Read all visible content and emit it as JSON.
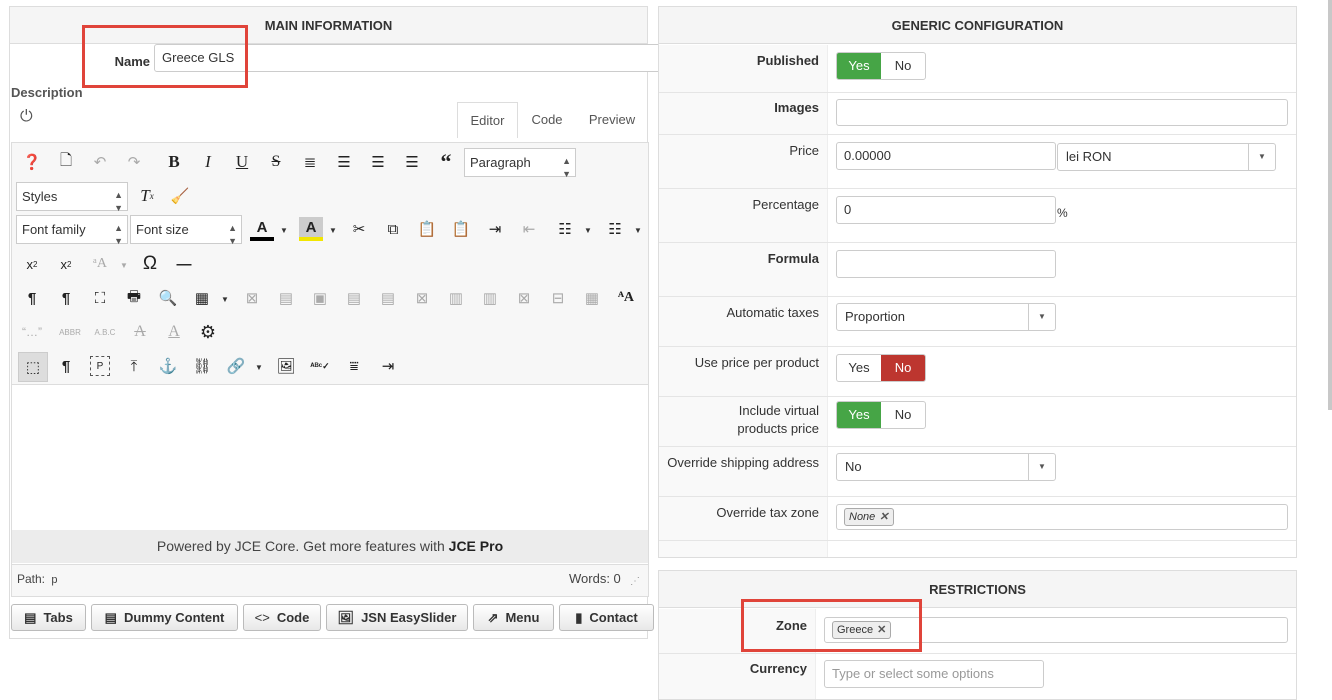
{
  "main": {
    "header": "MAIN INFORMATION",
    "name_label": "Name",
    "name_value": "Greece GLS",
    "description_label": "Description",
    "editor_tabs": [
      "Editor",
      "Code",
      "Preview"
    ],
    "paragraph_select": "Paragraph",
    "styles_select": "Styles",
    "font_family_select": "Font family",
    "font_size_select": "Font size",
    "powered_prefix": "Powered by JCE Core. Get more features with ",
    "powered_link": "JCE Pro",
    "path_label": "Path:",
    "path_value": "p",
    "words_label": "Words: 0",
    "buttons": [
      "Tabs",
      "Dummy Content",
      "Code",
      "JSN EasySlider",
      "Menu",
      "Contact"
    ]
  },
  "generic": {
    "header": "GENERIC CONFIGURATION",
    "published_label": "Published",
    "yes": "Yes",
    "no": "No",
    "images_label": "Images",
    "price_label": "Price",
    "price_value": "0.00000",
    "currency_value": "lei RON",
    "percentage_label": "Percentage",
    "percentage_value": "0",
    "percent_sign": "%",
    "formula_label": "Formula",
    "automatic_taxes_label": "Automatic taxes",
    "automatic_taxes_value": "Proportion",
    "use_price_label": "Use price per product",
    "include_virtual_label_1": "Include virtual",
    "include_virtual_label_2": "products price",
    "override_shipping_label": "Override shipping address",
    "override_shipping_value": "No",
    "override_tax_label": "Override tax zone",
    "override_tax_chip": "None"
  },
  "restrictions": {
    "header": "RESTRICTIONS",
    "zone_label": "Zone",
    "zone_chip": "Greece",
    "currency_label": "Currency",
    "currency_placeholder": "Type or select some options"
  },
  "colors": {
    "yes_green": "#46a546",
    "no_red": "#bd362f",
    "highlight_box": "#e0443a"
  }
}
